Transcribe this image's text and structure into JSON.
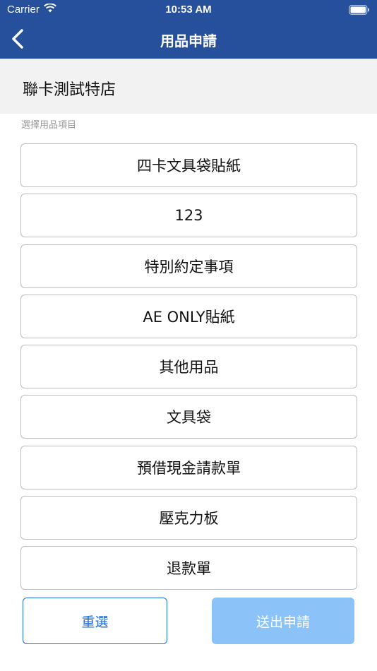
{
  "status_bar": {
    "carrier": "Carrier",
    "time": "10:53 AM"
  },
  "nav": {
    "title": "用品申請"
  },
  "store": {
    "name": "聯卡測試特店"
  },
  "section": {
    "label": "選擇用品項目"
  },
  "items": [
    "四卡文具袋貼紙",
    "123",
    "特別約定事項",
    "AE ONLY貼紙",
    "其他用品",
    "文具袋",
    "預借現金請款單",
    "壓克力板",
    "退款單"
  ],
  "actions": {
    "reset_label": "重選",
    "submit_label": "送出申請"
  },
  "colors": {
    "nav_bg": "#26509b",
    "accent": "#1e6ad6",
    "submit_disabled": "#8bc3f9"
  }
}
